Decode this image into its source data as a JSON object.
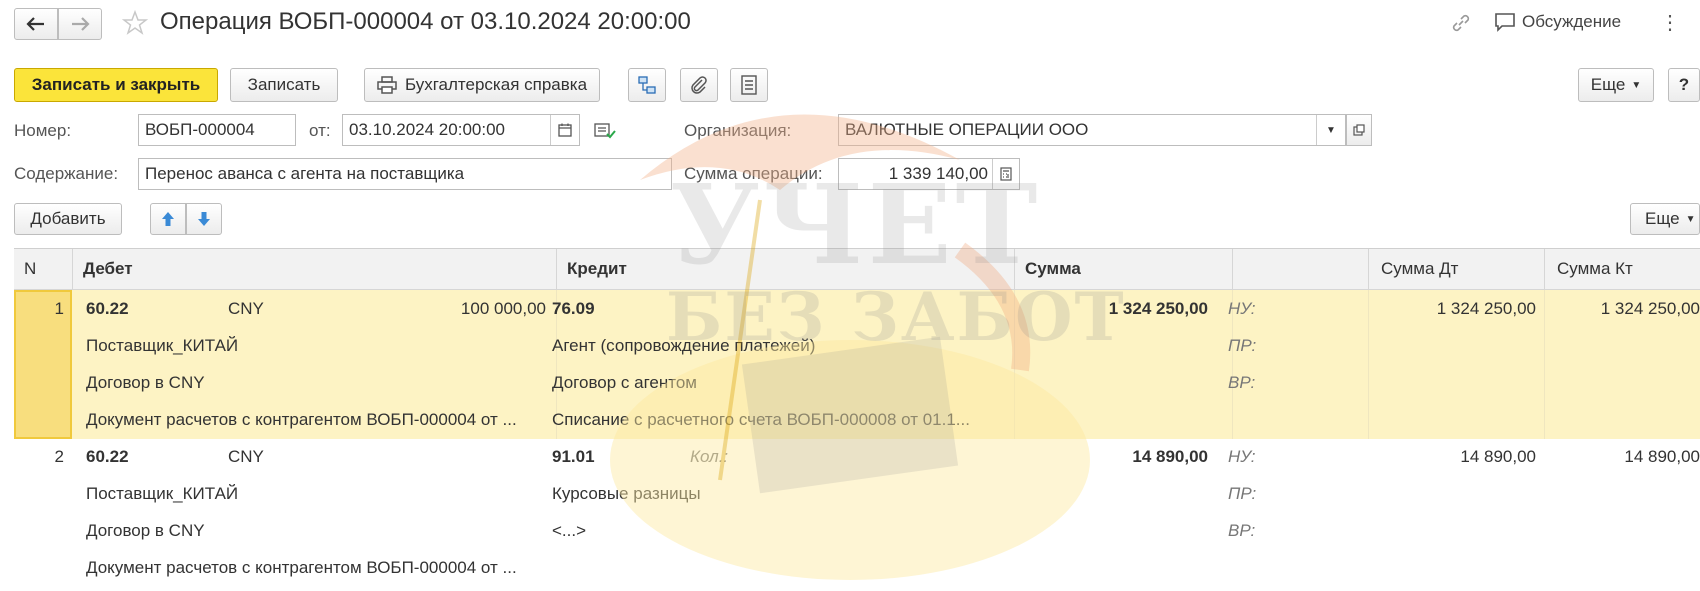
{
  "header": {
    "title": "Операция ВОБП-000004 от 03.10.2024 20:00:00",
    "discussion_label": "Обсуждение"
  },
  "toolbar": {
    "save_close_label": "Записать и закрыть",
    "save_label": "Записать",
    "report_label": "Бухгалтерская справка",
    "more_label": "Еще",
    "help_label": "?"
  },
  "form": {
    "number_label": "Номер:",
    "number_value": "ВОБП-000004",
    "date_label": "от:",
    "date_value": "03.10.2024 20:00:00",
    "org_label": "Организация:",
    "org_value": "ВАЛЮТНЫЕ ОПЕРАЦИИ ООО",
    "content_label": "Содержание:",
    "content_value": "Перенос аванса с агента на поставщика",
    "sum_label": "Сумма операции:",
    "sum_value": "1 339 140,00"
  },
  "table_toolbar": {
    "add_label": "Добавить",
    "more_label": "Еще"
  },
  "table": {
    "columns": [
      "N",
      "Дебет",
      "Кредит",
      "Сумма",
      "",
      "Сумма Дт",
      "Сумма Кт"
    ],
    "rows": [
      {
        "n": "1",
        "debit_account": "60.22",
        "debit_currency": "CNY",
        "debit_amount": "100 000,00",
        "debit_sub1": "Поставщик_КИТАЙ",
        "debit_sub2": "Договор в CNY",
        "debit_sub3": "Документ расчетов с контрагентом ВОБП-000004 от ...",
        "credit_account": "76.09",
        "credit_qty_label": "",
        "credit_sub1": "Агент (сопровождение платежей)",
        "credit_sub2": "Договор с агентом",
        "credit_sub3": "Списание с расчетного счета ВОБП-000008 от 01.1...",
        "sum": "1 324 250,00",
        "nu": "НУ:",
        "pr": "ПР:",
        "vr": "ВР:",
        "sum_dt": "1 324 250,00",
        "sum_kt": "1 324 250,00"
      },
      {
        "n": "2",
        "debit_account": "60.22",
        "debit_currency": "CNY",
        "debit_amount": "",
        "debit_sub1": "Поставщик_КИТАЙ",
        "debit_sub2": "Договор в CNY",
        "debit_sub3": "Документ расчетов с контрагентом ВОБП-000004 от ...",
        "credit_account": "91.01",
        "credit_qty_label": "Кол.:",
        "credit_sub1": "Курсовые разницы",
        "credit_sub2": "<...>",
        "credit_sub3": "",
        "sum": "14 890,00",
        "nu": "НУ:",
        "pr": "ПР:",
        "vr": "ВР:",
        "sum_dt": "14 890,00",
        "sum_kt": "14 890,00"
      }
    ]
  },
  "watermark": {
    "line1": "УЧЕТ",
    "line2": "БЕЗ ЗАБОТ"
  },
  "colors": {
    "primary_button": "#fbe43a",
    "selected_row": "#fdf3c4",
    "row_marker": "#f8de7e"
  }
}
